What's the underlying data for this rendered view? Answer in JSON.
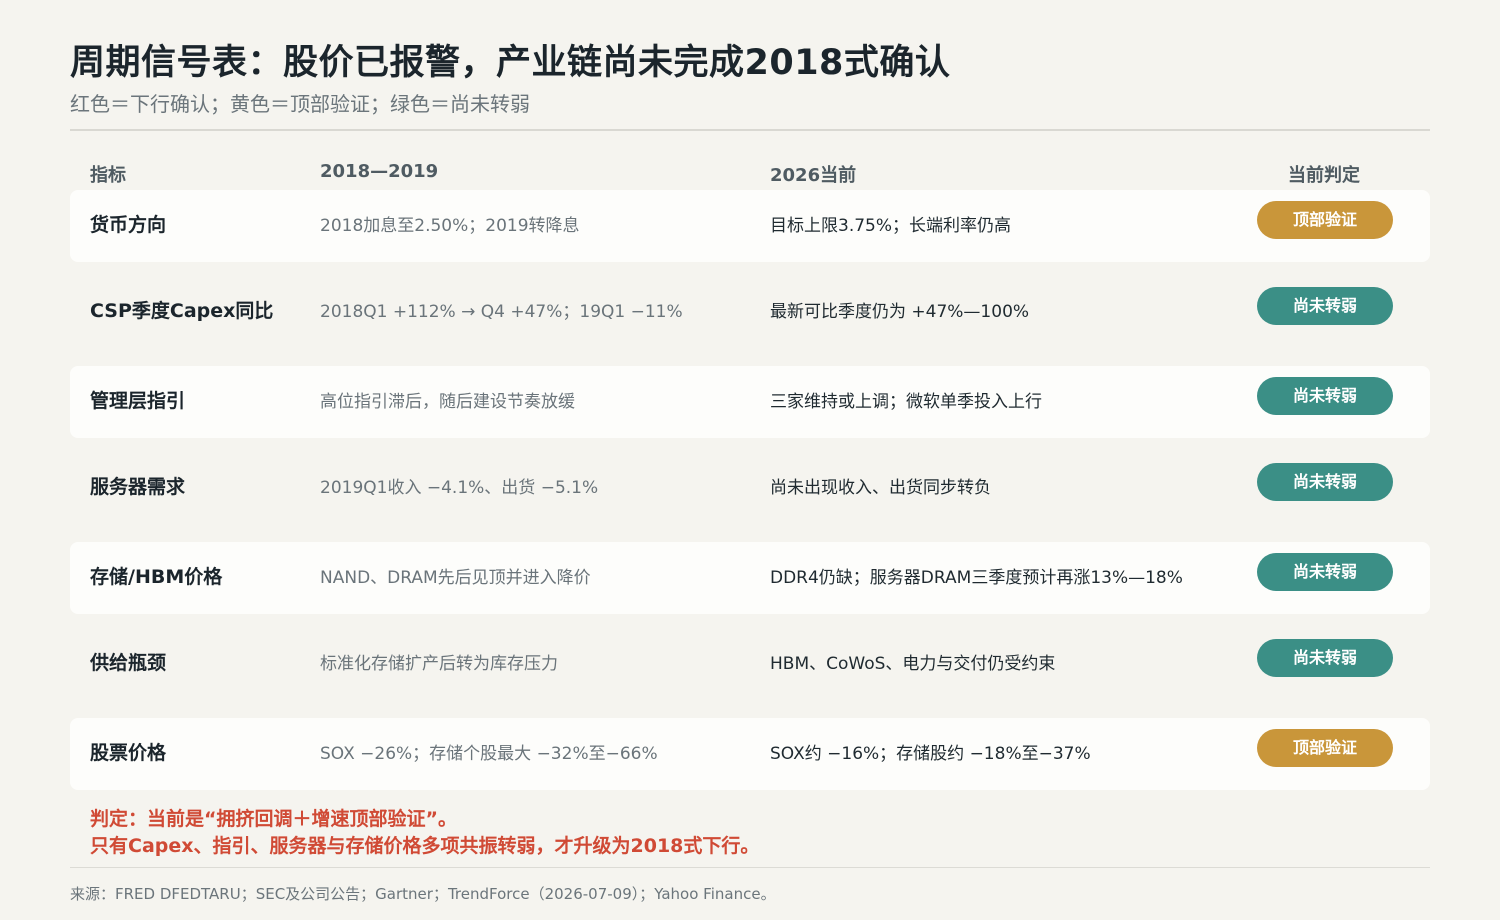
{
  "title": "周期信号表：股价已报警，产业链尚未完成2018式确认",
  "subtitle": "红色＝下行确认；黄色＝顶部验证；绿色＝尚未转弱",
  "colors": {
    "background": "#f5f4ef",
    "yellow_badge": "#c9963a",
    "green_badge": "#3b8f86",
    "verdict_red": "#d04a35"
  },
  "table": {
    "headers": {
      "indicator": "指标",
      "y2018": "2018—2019",
      "y2026": "2026当前",
      "judgement": "当前判定"
    },
    "rows": [
      {
        "indicator": "货币方向",
        "y2018": "2018加息至2.50%；2019转降息",
        "y2026": "目标上限3.75%；长端利率仍高",
        "judgement": "顶部验证",
        "status": "yellow"
      },
      {
        "indicator": "CSP季度Capex同比",
        "y2018": "2018Q1 +112% → Q4 +47%；19Q1 −11%",
        "y2026": "最新可比季度仍为 +47%—100%",
        "judgement": "尚未转弱",
        "status": "green"
      },
      {
        "indicator": "管理层指引",
        "y2018": "高位指引滞后，随后建设节奏放缓",
        "y2026": "三家维持或上调；微软单季投入上行",
        "judgement": "尚未转弱",
        "status": "green"
      },
      {
        "indicator": "服务器需求",
        "y2018": "2019Q1收入 −4.1%、出货 −5.1%",
        "y2026": "尚未出现收入、出货同步转负",
        "judgement": "尚未转弱",
        "status": "green"
      },
      {
        "indicator": "存储/HBM价格",
        "y2018": "NAND、DRAM先后见顶并进入降价",
        "y2026": "DDR4仍缺；服务器DRAM三季度预计再涨13%—18%",
        "judgement": "尚未转弱",
        "status": "green"
      },
      {
        "indicator": "供给瓶颈",
        "y2018": "标准化存储扩产后转为库存压力",
        "y2026": "HBM、CoWoS、电力与交付仍受约束",
        "judgement": "尚未转弱",
        "status": "green"
      },
      {
        "indicator": "股票价格",
        "y2018": "SOX −26%；存储个股最大 −32%至−66%",
        "y2026": "SOX约 −16%；存储股约 −18%至−37%",
        "judgement": "顶部验证",
        "status": "yellow"
      }
    ]
  },
  "verdict": {
    "line1": "判定：当前是“拥挤回调＋增速顶部验证”。",
    "line2": "只有Capex、指引、服务器与存储价格多项共振转弱，才升级为2018式下行。"
  },
  "source": "来源：FRED DFEDTARU；SEC及公司公告；Gartner；TrendForce（2026-07-09）；Yahoo Finance。"
}
